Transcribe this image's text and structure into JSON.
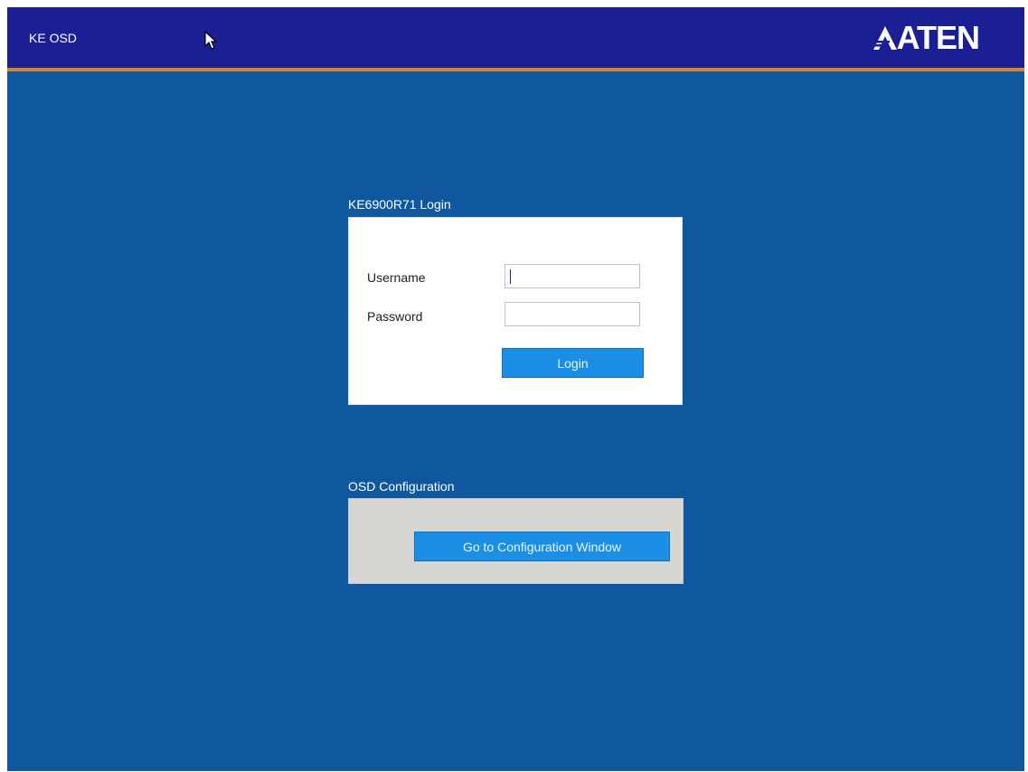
{
  "header": {
    "app_title": "KE OSD",
    "logo_text": "ATEN",
    "logo_icon": "aten-logo-icon",
    "background_color": "#1a1f93",
    "accent_color": "#d8822e"
  },
  "login": {
    "section_title": "KE6900R71 Login",
    "username_label": "Username",
    "username_value": "",
    "password_label": "Password",
    "password_value": "",
    "login_button": "Login"
  },
  "osd_config": {
    "section_title": "OSD Configuration",
    "config_button": "Go to Configuration Window"
  },
  "colors": {
    "screen_background": "#0f58a0",
    "button_background": "#1b8ee6"
  }
}
